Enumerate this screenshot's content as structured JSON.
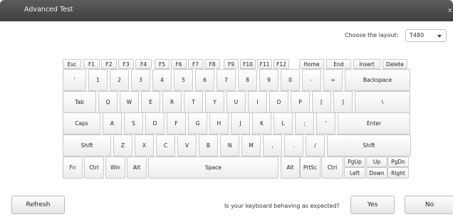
{
  "window": {
    "title": "Advanced Test",
    "close_label": "x"
  },
  "layout_picker": {
    "label": "Choose the layout:",
    "value": "T480"
  },
  "keyboard": {
    "row1": [
      "Esc",
      "F1",
      "F2",
      "F3",
      "F4",
      "F5",
      "F6",
      "F7",
      "F8",
      "F9",
      "F10",
      "F11",
      "F12",
      "Home",
      "End",
      "Insert",
      "Delete"
    ],
    "row2": [
      "'",
      "1",
      "2",
      "3",
      "4",
      "5",
      "6",
      "7",
      "8",
      "9",
      "0",
      "-",
      "=",
      "Backspace"
    ],
    "row3": [
      "Tab",
      "Q",
      "W",
      "E",
      "R",
      "T",
      "Y",
      "U",
      "I",
      "O",
      "P",
      "[",
      "]",
      "\\"
    ],
    "row4": [
      "Caps",
      "A",
      "S",
      "D",
      "F",
      "G",
      "H",
      "J",
      "K",
      "L",
      ";",
      "'",
      "Enter"
    ],
    "row5": [
      "Shift",
      "Z",
      "X",
      "C",
      "V",
      "B",
      "N",
      "M",
      ",",
      ".",
      "/",
      "Shift"
    ],
    "row6": [
      "Fn",
      "Ctrl",
      "Win",
      "Alt",
      "Space",
      "Alt",
      "PrtSc",
      "Ctrl",
      "PgUp",
      "Up",
      "PgDn",
      "Left",
      "Down",
      "Right"
    ]
  },
  "footer": {
    "refresh_label": "Refresh",
    "question": "Is your keyboard behaving as expected?",
    "yes_label": "Yes",
    "no_label": "No"
  }
}
